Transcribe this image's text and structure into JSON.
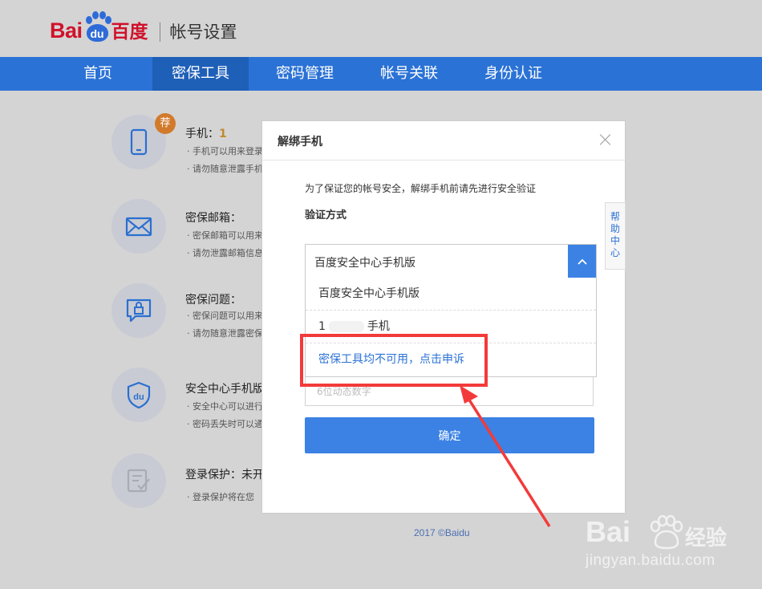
{
  "brand": {
    "logo_bai": "Bai",
    "logo_du": "du",
    "logo_cn": "百度",
    "section": "帐号设置"
  },
  "nav": [
    {
      "label": "首页"
    },
    {
      "label": "密保工具"
    },
    {
      "label": "密码管理"
    },
    {
      "label": "帐号关联"
    },
    {
      "label": "身份认证"
    }
  ],
  "rows": [
    {
      "title": "手机：",
      "value": "1",
      "badge": "荐",
      "desc1": "· 手机可以用来登录",
      "desc2": "· 请勿随意泄露手机",
      "icon": "phone-icon"
    },
    {
      "title": "密保邮箱：",
      "value": "",
      "desc1": "· 密保邮箱可以用来",
      "desc2": "· 请勿泄露邮箱信息",
      "icon": "mail-icon"
    },
    {
      "title": "密保问题：",
      "value": "",
      "desc1": "· 密保问题可以用来",
      "desc2": "· 请勿随意泄露密保",
      "icon": "lock-chat-icon"
    },
    {
      "title": "安全中心手机版",
      "value": "",
      "desc1": "· 安全中心可以进行",
      "desc2": "· 密码丢失时可以通",
      "icon": "shield-du-icon"
    },
    {
      "title": "登录保护：未开",
      "value": "",
      "desc1": "· 登录保护将在您",
      "desc2": "",
      "icon": "checklist-icon"
    }
  ],
  "modal": {
    "title": "解绑手机",
    "notice": "为了保证您的帐号安全，解绑手机前请先进行安全验证",
    "method_label": "验证方式",
    "selected": "百度安全中心手机版",
    "options": [
      {
        "label": "百度安全中心手机版"
      },
      {
        "prefix": "1",
        "suffix": "手机"
      },
      {
        "label": "密保工具均不可用，点击申诉"
      }
    ],
    "code_placeholder": "6位动态数字",
    "confirm": "确定"
  },
  "help_tab": [
    "帮",
    "助",
    "中",
    "心"
  ],
  "copyright": "2017 ©Baidu",
  "watermark": {
    "logo": "Bai",
    "cn": "经验",
    "url": "jingyan.baidu.com"
  },
  "colors": {
    "brand_red": "#d0112a",
    "nav_blue": "#2b72d6",
    "button_blue": "#3b82e4",
    "annotation_red": "#f33a3a"
  }
}
